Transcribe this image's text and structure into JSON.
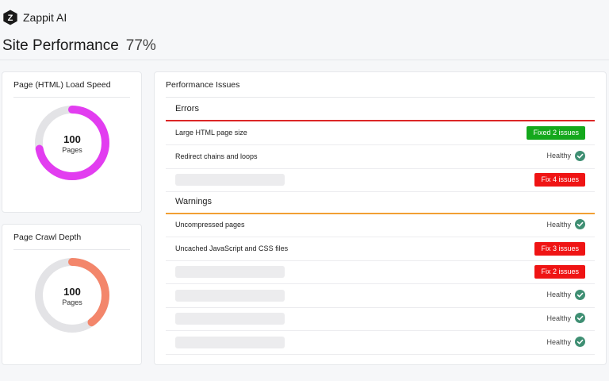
{
  "brand": {
    "name": "Zappit AI",
    "logo_letter": "Z"
  },
  "header": {
    "title": "Site Performance",
    "score": "77%"
  },
  "colors": {
    "load_speed_ring": "#e23df0",
    "crawl_depth_ring": "#f3866b",
    "track": "#e3e3e6",
    "error_line": "#dc2626",
    "warning_line": "#f2a033",
    "success_badge": "#14a81c",
    "danger_badge": "#ef1414",
    "healthy_check": "#3f8f73"
  },
  "load_speed": {
    "title": "Page (HTML) Load Speed",
    "value": "100",
    "unit": "Pages",
    "fraction": 0.72
  },
  "crawl_depth": {
    "title": "Page Crawl Depth",
    "value": "100",
    "unit": "Pages",
    "fraction": 0.4
  },
  "issues": {
    "title": "Performance Issues",
    "errors": {
      "title": "Errors",
      "rows": [
        {
          "label": "Large HTML page size",
          "status": "Fixed 2 issues"
        },
        {
          "label": "Redirect chains and loops",
          "status": "Healthy"
        },
        {
          "label": "",
          "status": "Fix 4 issues"
        }
      ]
    },
    "warnings": {
      "title": "Warnings",
      "rows": [
        {
          "label": "Uncompressed pages",
          "status": "Healthy"
        },
        {
          "label": "Uncached JavaScript and CSS files",
          "status": "Fix 3 issues"
        },
        {
          "label": "",
          "status": "Fix 2 issues"
        },
        {
          "label": "",
          "status": "Healthy"
        },
        {
          "label": "",
          "status": "Healthy"
        },
        {
          "label": "",
          "status": "Healthy"
        }
      ]
    }
  }
}
